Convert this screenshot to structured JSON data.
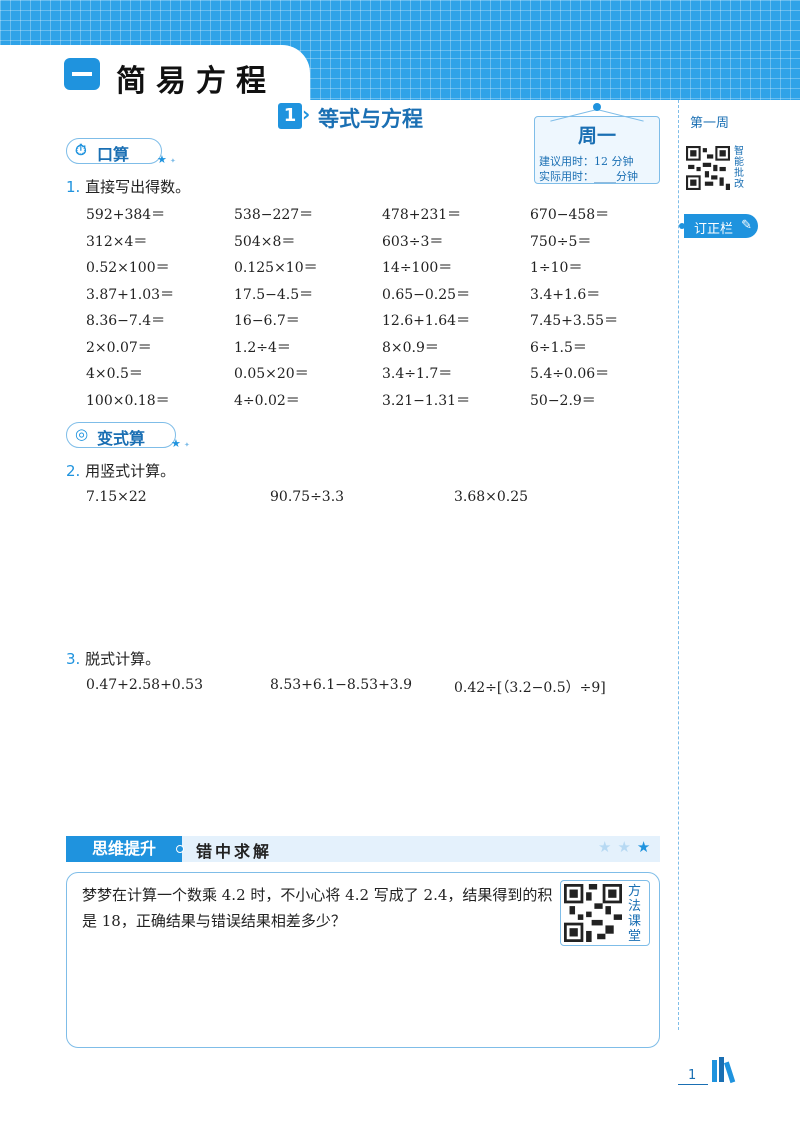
{
  "unit": {
    "title": "简易方程"
  },
  "lesson": {
    "number": "1",
    "title": "等式与方程"
  },
  "day_card": {
    "day": "周一",
    "suggested_time": "建议用时：12 分钟",
    "actual_time": "实际用时：____分钟"
  },
  "sidebar": {
    "week": "第一周",
    "qr_caption": "智能批改",
    "correction_label": "订正栏"
  },
  "sections": {
    "oral": {
      "label": "口算"
    },
    "variant": {
      "label": "变式算"
    }
  },
  "questions": {
    "q1": {
      "number": "1.",
      "prompt": "直接写出得数。"
    },
    "q2": {
      "number": "2.",
      "prompt": "用竖式计算。"
    },
    "q3": {
      "number": "3.",
      "prompt": "脱式计算。"
    }
  },
  "oral_problems": [
    [
      "592+384＝",
      "538−227＝",
      "478+231＝",
      "670−458＝"
    ],
    [
      "312×4＝",
      "504×8＝",
      "603÷3＝",
      "750÷5＝"
    ],
    [
      "0.52×100＝",
      "0.125×10＝",
      "14÷100＝",
      "1÷10＝"
    ],
    [
      "3.87+1.03＝",
      "17.5−4.5＝",
      "0.65−0.25＝",
      "3.4+1.6＝"
    ],
    [
      "8.36−7.4＝",
      "16−6.7＝",
      "12.6+1.64＝",
      "7.45+3.55＝"
    ],
    [
      "2×0.07＝",
      "1.2÷4＝",
      "8×0.9＝",
      "6÷1.5＝"
    ],
    [
      "4×0.5＝",
      "0.05×20＝",
      "3.4÷1.7＝",
      "5.4÷0.06＝"
    ],
    [
      "100×0.18＝",
      "4÷0.02＝",
      "3.21−1.31＝",
      "50−2.9＝"
    ]
  ],
  "vertical_problems": [
    "7.15×22",
    "90.75÷3.3",
    "3.68×0.25"
  ],
  "stepwise_problems": [
    "0.47+2.58+0.53",
    "8.53+6.1−8.53+3.9",
    "0.42÷[（3.2−0.5）÷9]"
  ],
  "thinking": {
    "label": "思维提升",
    "subtitle": "错中求解",
    "stars": [
      "★",
      "★",
      "★"
    ],
    "problem": "梦梦在计算一个数乘 4.2 时，不小心将 4.2 写成了 2.4，结果得到的积是 18，正确结果与错误结果相差多少？",
    "qr_caption": "方法课堂"
  },
  "footer": {
    "page_number": "1"
  },
  "colors": {
    "accent": "#1f93de",
    "accent_light": "#7fbde8",
    "band": "#2fa3e8",
    "title_blue": "#1a6fb3"
  }
}
